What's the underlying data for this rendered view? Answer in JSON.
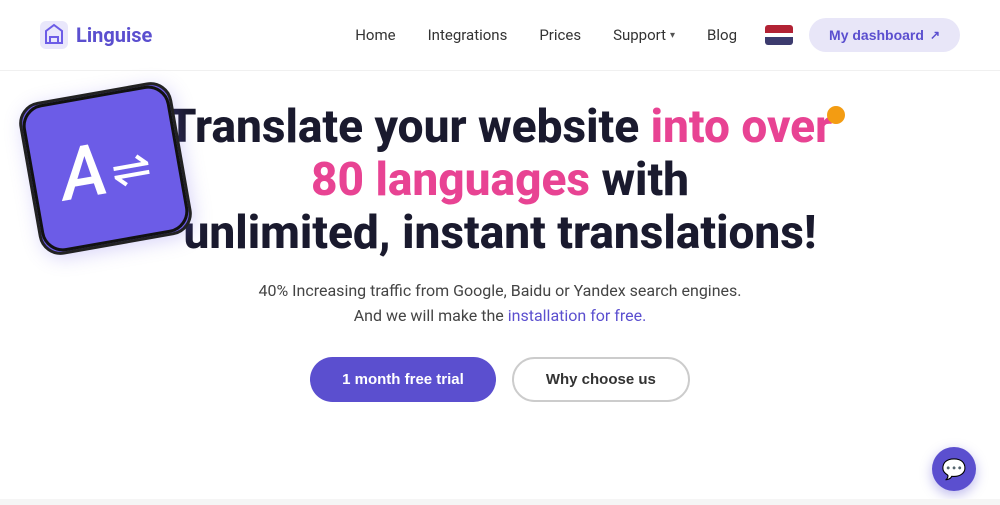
{
  "nav": {
    "logo_text": "Linguise",
    "links": [
      {
        "label": "Home",
        "id": "home"
      },
      {
        "label": "Integrations",
        "id": "integrations"
      },
      {
        "label": "Prices",
        "id": "prices"
      },
      {
        "label": "Support",
        "id": "support",
        "has_dropdown": true
      },
      {
        "label": "Blog",
        "id": "blog"
      }
    ],
    "dashboard_btn": "My dashboard"
  },
  "hero": {
    "headline_part1": "Translate your website ",
    "headline_highlight": "into over 80 languages",
    "headline_part2": " with unlimited, instant translations!",
    "subtitle_line1": "40% Increasing traffic from Google, Baidu or Yandex search engines.",
    "subtitle_line2": "And we will make the ",
    "subtitle_link": "installation for free.",
    "btn_primary": "1 month free trial",
    "btn_outline": "Why choose us"
  }
}
